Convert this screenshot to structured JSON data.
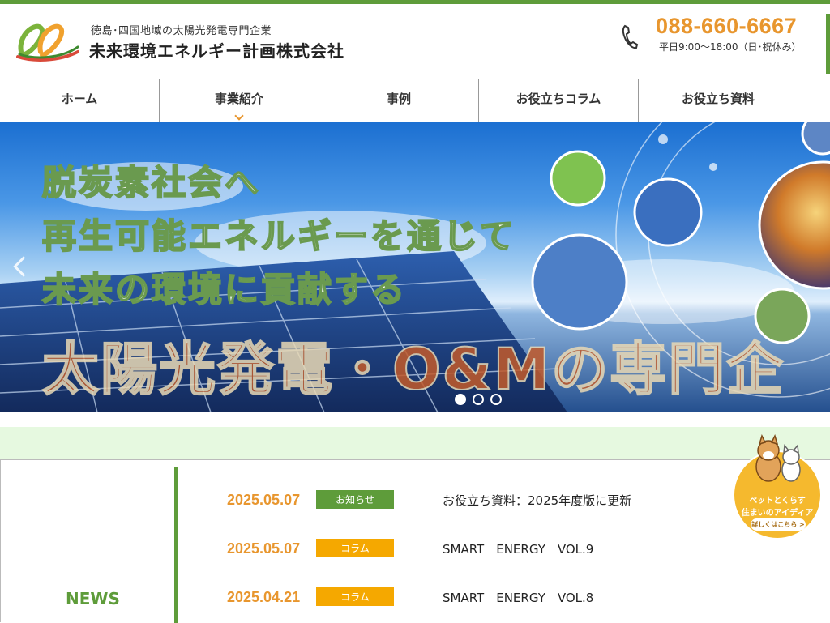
{
  "header": {
    "tagline": "徳島･四国地域の太陽光発電専門企業",
    "company_name": "未来環境エネルギー計画株式会社",
    "phone": "088-660-6667",
    "hours": "平日9:00〜18:00（日･祝休み）"
  },
  "nav": {
    "items": [
      {
        "label": "ホーム"
      },
      {
        "label": "事業紹介"
      },
      {
        "label": "事例"
      },
      {
        "label": "お役立ちコラム"
      },
      {
        "label": "お役立ち資料"
      }
    ]
  },
  "hero": {
    "line1": "脱炭素社会へ",
    "line2": "再生可能エネルギーを通じて",
    "line3": "未来の環境に貢献する",
    "line4": "太陽光発電・O&Mの専門企",
    "slide_count": 3,
    "active_slide": 1
  },
  "news": {
    "label": "NEWS",
    "items": [
      {
        "date": "2025.05.07",
        "category": "お知らせ",
        "title": "お役立ち資料：2025年度版に更新"
      },
      {
        "date": "2025.05.07",
        "category": "コラム",
        "title": "SMART　ENERGY　VOL.9"
      },
      {
        "date": "2025.04.21",
        "category": "コラム",
        "title": "SMART　ENERGY　VOL.8"
      }
    ]
  },
  "pet_banner": {
    "line1": "ペットとくらす",
    "line2": "住まいのアイディア",
    "button": "詳しくはこちら >"
  },
  "colors": {
    "brand_green": "#5e9c3a",
    "accent_orange": "#e8962e",
    "badge_news": "#5e9c3a",
    "badge_column": "#f5a800"
  }
}
